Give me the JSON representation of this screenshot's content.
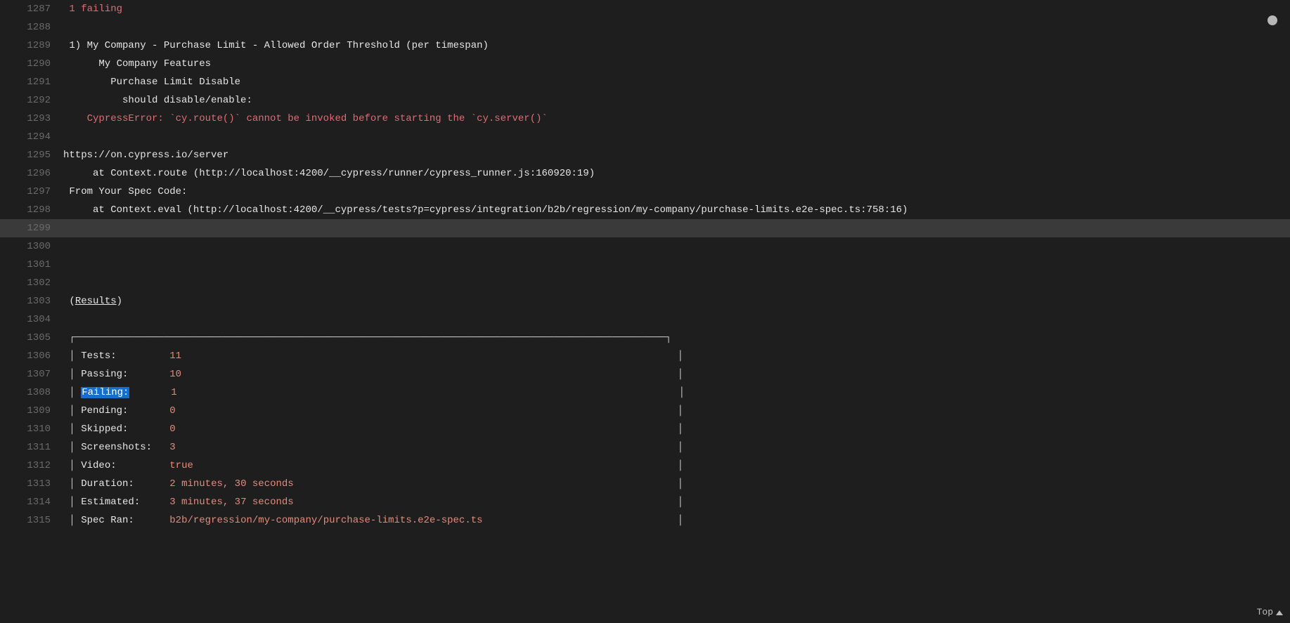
{
  "firstLineNumber": 1287,
  "currentLineIndex": 12,
  "bottomLabel": "Top",
  "modifiedIndicator": true,
  "tableEdgeCol": 103,
  "lines": [
    {
      "segments": [
        {
          "text": " ",
          "cls": ""
        },
        {
          "text": "1 failing",
          "cls": "red"
        }
      ]
    },
    {
      "segments": []
    },
    {
      "segments": [
        {
          "text": " 1) My Company - Purchase Limit - Allowed Order Threshold (per timespan)",
          "cls": "white"
        }
      ]
    },
    {
      "segments": [
        {
          "text": "      My Company Features",
          "cls": "white"
        }
      ]
    },
    {
      "segments": [
        {
          "text": "        Purchase Limit Disable",
          "cls": "white"
        }
      ]
    },
    {
      "segments": [
        {
          "text": "          should disable/enable:",
          "cls": "white"
        }
      ]
    },
    {
      "segments": [
        {
          "text": "    ",
          "cls": ""
        },
        {
          "text": "CypressError: `cy.route()` cannot be invoked before starting the `cy.server()`",
          "cls": "red"
        }
      ]
    },
    {
      "segments": []
    },
    {
      "segments": [
        {
          "text": "https://on.cypress.io/server",
          "cls": "white"
        }
      ]
    },
    {
      "segments": [
        {
          "text": "     at Context.route (http://localhost:4200/__cypress/runner/cypress_runner.js:160920:19)",
          "cls": "white"
        }
      ]
    },
    {
      "segments": [
        {
          "text": " From Your Spec Code:",
          "cls": "white"
        }
      ]
    },
    {
      "segments": [
        {
          "text": "     at Context.eval (http://localhost:4200/__cypress/tests?p=cypress/integration/b2b/regression/my-company/purchase-limits.e2e-spec.ts:758:16)",
          "cls": "white"
        }
      ]
    },
    {
      "segments": []
    },
    {
      "segments": []
    },
    {
      "segments": []
    },
    {
      "segments": []
    },
    {
      "segments": [
        {
          "text": " (",
          "cls": "white"
        },
        {
          "text": "Results",
          "cls": "white underline"
        },
        {
          "text": ")",
          "cls": "white"
        }
      ]
    },
    {
      "segments": []
    },
    {
      "tableBorder": "top"
    },
    {
      "tableRow": {
        "label": "Tests:",
        "value": "11"
      }
    },
    {
      "tableRow": {
        "label": "Passing:",
        "value": "10"
      }
    },
    {
      "tableRow": {
        "label": "Failing:",
        "value": "1",
        "labelSelected": true
      }
    },
    {
      "tableRow": {
        "label": "Pending:",
        "value": "0"
      }
    },
    {
      "tableRow": {
        "label": "Skipped:",
        "value": "0"
      }
    },
    {
      "tableRow": {
        "label": "Screenshots:",
        "value": "3"
      }
    },
    {
      "tableRow": {
        "label": "Video:",
        "value": "true"
      }
    },
    {
      "tableRow": {
        "label": "Duration:",
        "value": "2 minutes, 30 seconds"
      }
    },
    {
      "tableRow": {
        "label": "Estimated:",
        "value": "3 minutes, 37 seconds"
      }
    },
    {
      "tableRow": {
        "label": "Spec Ran:",
        "value": "b2b/regression/my-company/purchase-limits.e2e-spec.ts"
      }
    }
  ]
}
